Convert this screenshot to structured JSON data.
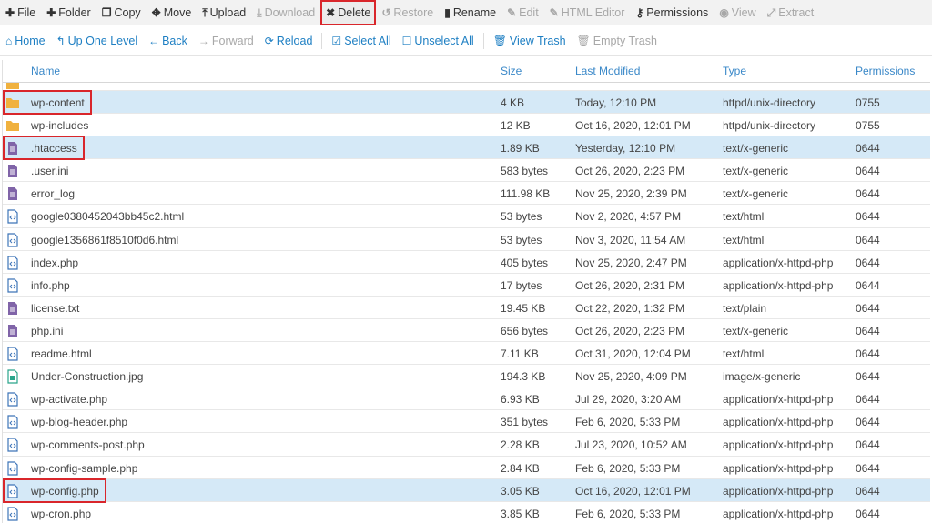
{
  "toolbar": {
    "items": [
      {
        "label": "File",
        "icon": "plus-icon",
        "glyph": "✚",
        "state": "normal"
      },
      {
        "label": "Folder",
        "icon": "plus-icon",
        "glyph": "✚",
        "state": "normal"
      },
      {
        "label": "Copy",
        "icon": "copy-icon",
        "glyph": "❐",
        "state": "underlined"
      },
      {
        "label": "Move",
        "icon": "move-icon",
        "glyph": "✥",
        "state": "underlined"
      },
      {
        "label": "Upload",
        "icon": "upload-icon",
        "glyph": "⤒",
        "state": "normal"
      },
      {
        "label": "Download",
        "icon": "download-icon",
        "glyph": "⤓",
        "state": "disabled"
      },
      {
        "label": "Delete",
        "icon": "delete-icon",
        "glyph": "✖",
        "state": "highlighted"
      },
      {
        "label": "Restore",
        "icon": "restore-icon",
        "glyph": "↺",
        "state": "disabled"
      },
      {
        "label": "Rename",
        "icon": "rename-icon",
        "glyph": "▮",
        "state": "normal"
      },
      {
        "label": "Edit",
        "icon": "pencil-icon",
        "glyph": "✎",
        "state": "disabled"
      },
      {
        "label": "HTML Editor",
        "icon": "html-editor-icon",
        "glyph": "✎",
        "state": "disabled"
      },
      {
        "label": "Permissions",
        "icon": "key-icon",
        "glyph": "⚷",
        "state": "normal"
      },
      {
        "label": "View",
        "icon": "eye-icon",
        "glyph": "◉",
        "state": "disabled"
      },
      {
        "label": "Extract",
        "icon": "extract-icon",
        "glyph": "⤢",
        "state": "disabled"
      }
    ]
  },
  "navbar": {
    "items": [
      {
        "label": "Home",
        "icon": "home-icon",
        "glyph": "⌂",
        "state": "normal"
      },
      {
        "label": "Up One Level",
        "icon": "level-up-icon",
        "glyph": "↰",
        "state": "normal"
      },
      {
        "label": "Back",
        "icon": "arrow-left-icon",
        "glyph": "←",
        "state": "normal"
      },
      {
        "label": "Forward",
        "icon": "arrow-right-icon",
        "glyph": "→",
        "state": "disabled"
      },
      {
        "label": "Reload",
        "icon": "reload-icon",
        "glyph": "⟳",
        "state": "normal"
      },
      {
        "label": "Select All",
        "icon": "check-square-icon",
        "glyph": "☑",
        "state": "normal"
      },
      {
        "label": "Unselect All",
        "icon": "square-icon",
        "glyph": "☐",
        "state": "normal"
      },
      {
        "label": "View Trash",
        "icon": "trash-icon",
        "glyph": "🗑",
        "state": "normal"
      },
      {
        "label": "Empty Trash",
        "icon": "trash-icon",
        "glyph": "🗑",
        "state": "disabled"
      }
    ]
  },
  "table": {
    "columns": {
      "name": "Name",
      "size": "Size",
      "modified": "Last Modified",
      "type": "Type",
      "permissions": "Permissions"
    },
    "rows": [
      {
        "kind": "folder",
        "name": "wp-content",
        "size": "4 KB",
        "modified": "Today, 12:10 PM",
        "type": "httpd/unix-directory",
        "perms": "0755",
        "selected": true,
        "boxed": true
      },
      {
        "kind": "folder",
        "name": "wp-includes",
        "size": "12 KB",
        "modified": "Oct 16, 2020, 12:01 PM",
        "type": "httpd/unix-directory",
        "perms": "0755",
        "selected": false,
        "boxed": false
      },
      {
        "kind": "text",
        "name": ".htaccess",
        "size": "1.89 KB",
        "modified": "Yesterday, 12:10 PM",
        "type": "text/x-generic",
        "perms": "0644",
        "selected": true,
        "boxed": true
      },
      {
        "kind": "text",
        "name": ".user.ini",
        "size": "583 bytes",
        "modified": "Oct 26, 2020, 2:23 PM",
        "type": "text/x-generic",
        "perms": "0644",
        "selected": false,
        "boxed": false
      },
      {
        "kind": "text",
        "name": "error_log",
        "size": "111.98 KB",
        "modified": "Nov 25, 2020, 2:39 PM",
        "type": "text/x-generic",
        "perms": "0644",
        "selected": false,
        "boxed": false
      },
      {
        "kind": "code",
        "name": "google0380452043bb45c2.html",
        "size": "53 bytes",
        "modified": "Nov 2, 2020, 4:57 PM",
        "type": "text/html",
        "perms": "0644",
        "selected": false,
        "boxed": false
      },
      {
        "kind": "code",
        "name": "google1356861f8510f0d6.html",
        "size": "53 bytes",
        "modified": "Nov 3, 2020, 11:54 AM",
        "type": "text/html",
        "perms": "0644",
        "selected": false,
        "boxed": false
      },
      {
        "kind": "code",
        "name": "index.php",
        "size": "405 bytes",
        "modified": "Nov 25, 2020, 2:47 PM",
        "type": "application/x-httpd-php",
        "perms": "0644",
        "selected": false,
        "boxed": false
      },
      {
        "kind": "code",
        "name": "info.php",
        "size": "17 bytes",
        "modified": "Oct 26, 2020, 2:31 PM",
        "type": "application/x-httpd-php",
        "perms": "0644",
        "selected": false,
        "boxed": false
      },
      {
        "kind": "text",
        "name": "license.txt",
        "size": "19.45 KB",
        "modified": "Oct 22, 2020, 1:32 PM",
        "type": "text/plain",
        "perms": "0644",
        "selected": false,
        "boxed": false
      },
      {
        "kind": "text",
        "name": "php.ini",
        "size": "656 bytes",
        "modified": "Oct 26, 2020, 2:23 PM",
        "type": "text/x-generic",
        "perms": "0644",
        "selected": false,
        "boxed": false
      },
      {
        "kind": "code",
        "name": "readme.html",
        "size": "7.11 KB",
        "modified": "Oct 31, 2020, 12:04 PM",
        "type": "text/html",
        "perms": "0644",
        "selected": false,
        "boxed": false
      },
      {
        "kind": "image",
        "name": "Under-Construction.jpg",
        "size": "194.3 KB",
        "modified": "Nov 25, 2020, 4:09 PM",
        "type": "image/x-generic",
        "perms": "0644",
        "selected": false,
        "boxed": false
      },
      {
        "kind": "code",
        "name": "wp-activate.php",
        "size": "6.93 KB",
        "modified": "Jul 29, 2020, 3:20 AM",
        "type": "application/x-httpd-php",
        "perms": "0644",
        "selected": false,
        "boxed": false
      },
      {
        "kind": "code",
        "name": "wp-blog-header.php",
        "size": "351 bytes",
        "modified": "Feb 6, 2020, 5:33 PM",
        "type": "application/x-httpd-php",
        "perms": "0644",
        "selected": false,
        "boxed": false
      },
      {
        "kind": "code",
        "name": "wp-comments-post.php",
        "size": "2.28 KB",
        "modified": "Jul 23, 2020, 10:52 AM",
        "type": "application/x-httpd-php",
        "perms": "0644",
        "selected": false,
        "boxed": false
      },
      {
        "kind": "code",
        "name": "wp-config-sample.php",
        "size": "2.84 KB",
        "modified": "Feb 6, 2020, 5:33 PM",
        "type": "application/x-httpd-php",
        "perms": "0644",
        "selected": false,
        "boxed": false
      },
      {
        "kind": "code",
        "name": "wp-config.php",
        "size": "3.05 KB",
        "modified": "Oct 16, 2020, 12:01 PM",
        "type": "application/x-httpd-php",
        "perms": "0644",
        "selected": true,
        "boxed": true
      },
      {
        "kind": "code",
        "name": "wp-cron.php",
        "size": "3.85 KB",
        "modified": "Feb 6, 2020, 5:33 PM",
        "type": "application/x-httpd-php",
        "perms": "0644",
        "selected": false,
        "boxed": false
      }
    ]
  },
  "colors": {
    "link_blue": "#1e7fc3",
    "header_blue": "#3a88c8",
    "selected_row": "#d5e9f7",
    "highlight_red": "#d9262b",
    "folder_orange": "#f0b13e",
    "text_file_purple": "#8064a8",
    "code_file_blue": "#3d74b8",
    "image_file_teal": "#2aa58b"
  }
}
